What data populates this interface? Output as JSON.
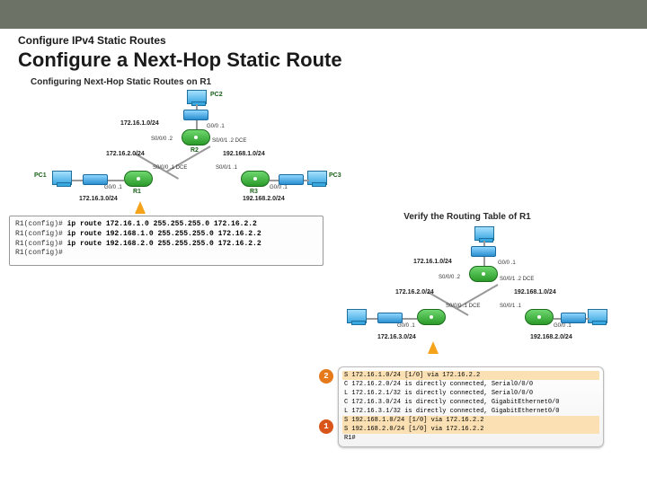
{
  "header": {
    "kicker": "Configure IPv4 Static Routes",
    "title": "Configure a Next-Hop Static Route"
  },
  "figure1": {
    "title": "Configuring Next-Hop Static Routes on R1",
    "devices": {
      "r1": "R1",
      "r2": "R2",
      "r3": "R3",
      "pc1": "PC1",
      "pc2": "PC2",
      "pc3": "PC3"
    },
    "nets": {
      "n_pc2": "172.16.1.0/24",
      "n_r1r2": "172.16.2.0/24",
      "n_r2r3": "192.168.1.0/24",
      "n_pc1": "172.16.3.0/24",
      "n_pc3": "192.168.2.0/24"
    },
    "iface": {
      "r2_g0": "G0/0 .1",
      "r2_s000": "S0/0/0 .2",
      "r2_s001": "S0/0/1 .2 DCE",
      "r1_s000": "S0/0/0 .1 DCE",
      "r3_s001": "S0/0/1 .1",
      "r1_g0": "G0/0 .1",
      "r3_g0": "G0/0 .1"
    }
  },
  "cli": {
    "lines": [
      {
        "prompt": "R1(config)#",
        "cmd": "ip route 172.16.1.0 255.255.255.0 172.16.2.2"
      },
      {
        "prompt": "R1(config)#",
        "cmd": "ip route 192.168.1.0 255.255.255.0 172.16.2.2"
      },
      {
        "prompt": "R1(config)#",
        "cmd": "ip route 192.168.2.0 255.255.255.0 172.16.2.2"
      },
      {
        "prompt": "R1(config)#",
        "cmd": ""
      }
    ]
  },
  "figure2": {
    "title": "Verify the Routing Table of R1",
    "nets": {
      "n_pc2": "172.16.1.0/24",
      "n_r1r2": "172.16.2.0/24",
      "n_r2r3": "192.168.1.0/24",
      "n_pc1": "172.16.3.0/24",
      "n_pc3": "192.168.2.0/24"
    },
    "iface": {
      "r2_g0": "G0/0 .1",
      "r2_s000": "S0/0/0 .2",
      "r2_s001": "S0/0/1 .2 DCE",
      "r1_s000": "S0/0/0 .1 DCE",
      "r3_s001": "S0/0/1 .1",
      "r1_g0": "G0/0 .1",
      "r3_g0": "G0/0 .1"
    }
  },
  "routing_table": {
    "rows": [
      "S    172.16.1.0/24 [1/0] via 172.16.2.2",
      "C    172.16.2.0/24 is directly connected, Serial0/0/0",
      "L    172.16.2.1/32 is directly connected, Serial0/0/0",
      "C    172.16.3.0/24 is directly connected, GigabitEthernet0/0",
      "L    172.16.3.1/32 is directly connected, GigabitEthernet0/0",
      "S    192.168.1.0/24 [1/0] via 172.16.2.2",
      "S    192.168.2.0/24 [1/0] via 172.16.2.2",
      "R1#"
    ],
    "hl": [
      0,
      5,
      6
    ],
    "markers": {
      "row0": "2",
      "row6": "1"
    }
  }
}
